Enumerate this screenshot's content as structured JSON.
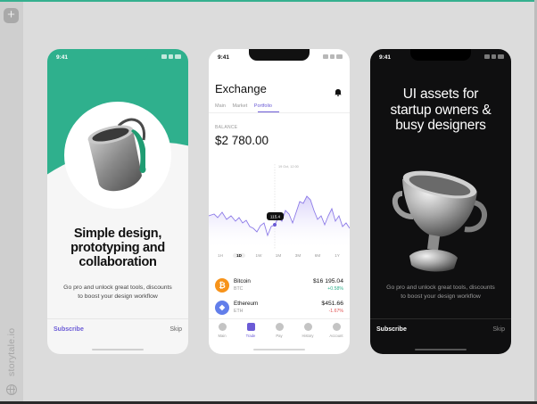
{
  "sidebar": {
    "add_label": "+",
    "brand": "storytale.io"
  },
  "phone1": {
    "time": "9:41",
    "headline": [
      "Simple design,",
      "prototyping and",
      "collaboration"
    ],
    "subtitle": [
      "Go pro and unlock great tools, discounts",
      "to boost your design workflow"
    ],
    "subscribe_label": "Subscribe",
    "skip_label": "Skip",
    "colors": {
      "accent": "#2fb08d",
      "link": "#6b5bd6"
    }
  },
  "phone2": {
    "time": "9:41",
    "title": "Exchange",
    "tabs": [
      "Main",
      "Market",
      "Portfolio"
    ],
    "active_tab": "Portfolio",
    "balance_label": "BALANCE",
    "balance_value": "$2 780.00",
    "chart_tooltip_date": "19 Oct, 12:00",
    "chart_marker_value": "115.4",
    "ranges": [
      "1H",
      "1D",
      "1W",
      "1M",
      "3M",
      "6M",
      "1Y"
    ],
    "selected_range": "1D",
    "coins": [
      {
        "name": "Bitcoin",
        "ticker": "BTC",
        "price": "$16 195.04",
        "change": "+0.58%",
        "color": "#f7931a",
        "symbol": "₿",
        "change_color": "#2fb08d"
      },
      {
        "name": "Ethereum",
        "ticker": "ETH",
        "price": "$451.66",
        "change": "-1.67%",
        "color": "#627eea",
        "symbol": "◆",
        "change_color": "#e05252"
      }
    ],
    "nav": [
      "Main",
      "Trade",
      "Pay",
      "History",
      "Account"
    ],
    "active_nav": "Trade"
  },
  "phone3": {
    "time": "9:41",
    "headline": [
      "UI assets for",
      "startup owners &",
      "busy designers"
    ],
    "subtitle": [
      "Go pro and unlock great tools, discounts",
      "to boost your design workflow"
    ],
    "subscribe_label": "Subscribe",
    "skip_label": "Skip"
  }
}
